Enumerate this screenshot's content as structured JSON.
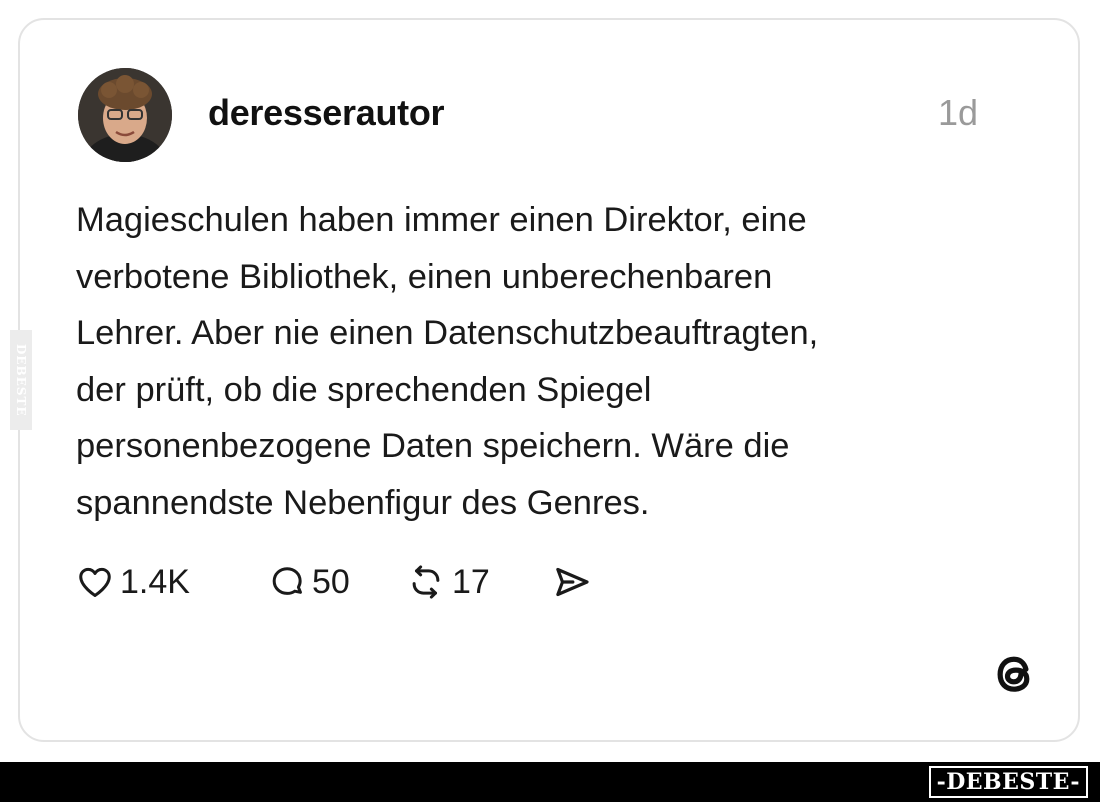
{
  "post": {
    "username": "deresserautor",
    "time": "1d",
    "text_lines": [
      "Magieschulen haben immer einen Direktor, eine",
      "verbotene Bibliothek, einen unberechenbaren",
      "Lehrer. Aber nie einen Datenschutzbeauftragten,",
      "der prüft, ob die sprechenden Spiegel",
      "personenbezogene Daten speichern. Wäre die",
      "spannendste Nebenfigur des Genres."
    ]
  },
  "actions": {
    "likes": "1.4K",
    "comments": "50",
    "reposts": "17",
    "icons": [
      "heart-icon",
      "comment-icon",
      "repost-icon",
      "share-icon"
    ]
  },
  "branding": {
    "app_logo": "threads-logo-icon",
    "side_watermark": "DEBESTE",
    "watermark": "-DEBESTE-"
  },
  "colors": {
    "text": "#1a1a1a",
    "muted": "#9a9a9a",
    "card_border": "#e3e3e3",
    "bottom_bar": "#000000"
  }
}
